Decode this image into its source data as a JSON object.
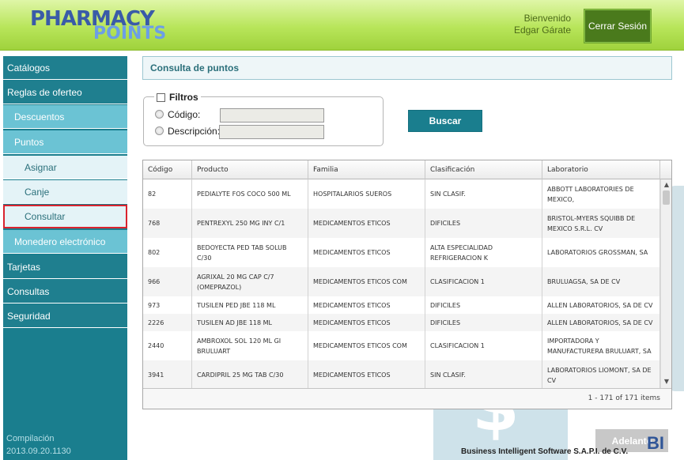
{
  "header": {
    "logo_top": "PHARMACY",
    "logo_bottom": "POINTS",
    "welcome": "Bienvenido",
    "user_name": "Edgar Gárate",
    "logout_label": "Cerrar Sesión"
  },
  "sidebar": {
    "items": [
      {
        "label": "Catálogos",
        "level": 0
      },
      {
        "label": "Reglas de oferteo",
        "level": 0
      },
      {
        "label": "Descuentos",
        "level": 1
      },
      {
        "label": "Puntos",
        "level": 1
      },
      {
        "label": "Asignar",
        "level": 2
      },
      {
        "label": "Canje",
        "level": 2
      },
      {
        "label": "Consultar",
        "level": 2,
        "active": true
      },
      {
        "label": "Monedero electrónico",
        "level": 1
      },
      {
        "label": "Tarjetas",
        "level": 0
      },
      {
        "label": "Consultas",
        "level": 0
      },
      {
        "label": "Seguridad",
        "level": 0
      }
    ],
    "compile_label": "Compilación",
    "compile_version": "2013.09.20.1130"
  },
  "main": {
    "title": "Consulta de puntos",
    "filters": {
      "legend": "Filtros",
      "code_label": "Código:",
      "code_value": "",
      "description_label": "Descripción:",
      "description_value": ""
    },
    "search_label": "Buscar",
    "grid": {
      "columns": [
        "Código",
        "Producto",
        "Familia",
        "Clasificación",
        "Laboratorio"
      ],
      "rows": [
        [
          "82",
          "PEDIALYTE FOS COCO 500 ML",
          "HOSPITALARIOS SUEROS",
          "SIN CLASIF.",
          "ABBOTT LABORATORIES DE MEXICO,"
        ],
        [
          "768",
          "PENTREXYL 250 MG INY C/1",
          "MEDICAMENTOS ETICOS",
          "DIFICILES",
          "BRISTOL-MYERS SQUIBB DE MEXICO S.R.L. CV"
        ],
        [
          "802",
          "BEDOYECTA PED TAB SOLUB C/30",
          "MEDICAMENTOS ETICOS",
          "ALTA ESPECIALIDAD REFRIGERACION K",
          "LABORATORIOS GROSSMAN, SA"
        ],
        [
          "966",
          "AGRIXAL 20 MG CAP C/7 (OMEPRAZOL)",
          "MEDICAMENTOS ETICOS COM",
          "CLASIFICACION 1",
          "BRULUAGSA, SA DE CV"
        ],
        [
          "973",
          "TUSILEN PED JBE 118 ML",
          "MEDICAMENTOS ETICOS",
          "DIFICILES",
          "ALLEN LABORATORIOS, SA DE CV"
        ],
        [
          "2226",
          "TUSILEN AD JBE 118 ML",
          "MEDICAMENTOS ETICOS",
          "DIFICILES",
          "ALLEN LABORATORIOS, SA DE CV"
        ],
        [
          "2440",
          "AMBROXOL SOL 120 ML GI BRULUART",
          "MEDICAMENTOS ETICOS COM",
          "CLASIFICACION 1",
          "IMPORTADORA Y MANUFACTURERA BRULUART, SA"
        ],
        [
          "3941",
          "CARDIPRIL 25 MG TAB C/30",
          "MEDICAMENTOS ETICOS",
          "SIN CLASIF.",
          "LABORATORIOS LIOMONT, SA DE CV"
        ]
      ],
      "pager": "1 - 171 of 171 items"
    },
    "next_label": "Adelante",
    "footer_company": "Business Intelligent Software S.A.P.I. de C.V.",
    "footer_logo": "BI"
  }
}
